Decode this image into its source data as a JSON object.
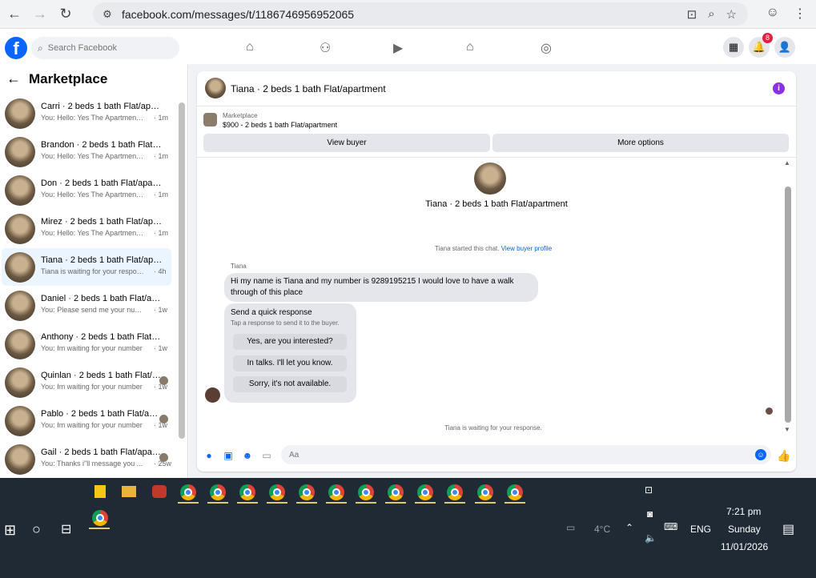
{
  "browser": {
    "url": "facebook.com/messages/t/1186746956952065"
  },
  "fb_header": {
    "logo": "f",
    "search_placeholder": "Search Facebook",
    "notification_count": "8"
  },
  "left_panel": {
    "title": "Marketplace",
    "conversations": [
      {
        "name": "Carri · 2 beds 1 bath Flat/apartment",
        "snippet": "You: Hello: Yes The Apartment Is ...",
        "time": "· 1m"
      },
      {
        "name": "Brandon · 2 beds 1 bath Flat/apartment",
        "snippet": "You: Hello: Yes The Apartment Is ...",
        "time": "· 1m"
      },
      {
        "name": "Don · 2 beds 1 bath Flat/apartment",
        "snippet": "You: Hello: Yes The Apartment Is ...",
        "time": "· 1m"
      },
      {
        "name": "Mirez · 2 beds 1 bath Flat/apartment",
        "snippet": "You: Hello: Yes The Apartment Is ...",
        "time": "· 1m"
      },
      {
        "name": "Tiana · 2 beds 1 bath Flat/apartment",
        "snippet": "Tiana is waiting for your response.",
        "time": "· 4h"
      },
      {
        "name": "Daniel · 2 beds 1 bath Flat/apartment",
        "snippet": "You: Please send me your number...",
        "time": "· 1w"
      },
      {
        "name": "Anthony · 2 beds 1 bath Flat/apartment",
        "snippet": "You: Im waiting for your number",
        "time": "· 1w"
      },
      {
        "name": "Quinlan · 2 beds 1 bath Flat/apartment",
        "snippet": "You: Im waiting for your number",
        "time": "· 1w"
      },
      {
        "name": "Pablo · 2 beds 1 bath Flat/apartment",
        "snippet": "You: Im waiting for your number",
        "time": "· 1w"
      },
      {
        "name": "Gail · 2 beds 1 bath Flat/apartment",
        "snippet": "You: Thanks i\"ll message you ...",
        "time": "· 25w"
      }
    ]
  },
  "chat": {
    "header_title": "Tiana · 2 beds 1 bath Flat/apartment",
    "listing_label": "Marketplace",
    "listing_price": "$900 - 2 beds 1 bath Flat/apartment",
    "view_buyer": "View buyer",
    "more_options": "More options",
    "profile_name": "Tiana · 2 beds 1 bath Flat/apartment",
    "started_text": "Tiana started this chat.",
    "view_profile_link": "View buyer profile",
    "sender": "Tiana",
    "message": "Hi my name is Tiana and my number is 9289195215 I would love to have a walk through of this place",
    "quick_title": "Send a quick response",
    "quick_subtitle": "Tap a response to send it to the buyer.",
    "quick_options": [
      "Yes, are you interested?",
      "In talks. I'll let you know.",
      "Sorry, it's not available."
    ],
    "waiting_text": "Tiana is waiting for your response.",
    "input_placeholder": "Aa"
  },
  "taskbar": {
    "weather": "4°C",
    "language": "ENG",
    "time": "7:21 pm",
    "day": "Sunday",
    "date": "11/01/2026"
  }
}
